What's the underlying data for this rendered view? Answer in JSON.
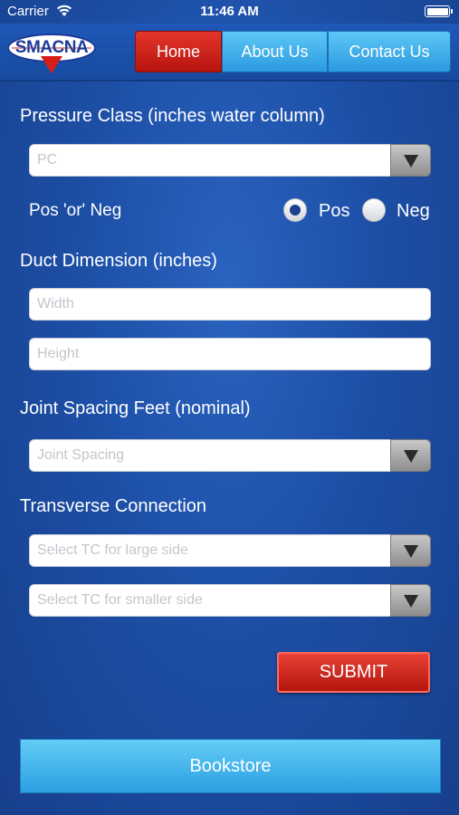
{
  "status_bar": {
    "carrier": "Carrier",
    "time": "11:46 AM"
  },
  "header": {
    "logo_text": "SMACNA",
    "nav": {
      "home": "Home",
      "about": "About Us",
      "contact": "Contact Us"
    },
    "active_tab": "home"
  },
  "pressure_class": {
    "label": "Pressure Class (inches water column)",
    "placeholder": "PC"
  },
  "pos_neg": {
    "label": "Pos 'or' Neg",
    "pos_label": "Pos",
    "neg_label": "Neg",
    "selected": "pos"
  },
  "duct_dimension": {
    "label": "Duct Dimension (inches)",
    "width_placeholder": "Width",
    "height_placeholder": "Height"
  },
  "joint_spacing": {
    "label": "Joint Spacing Feet (nominal)",
    "placeholder": "Joint Spacing"
  },
  "transverse_connection": {
    "label": "Transverse Connection",
    "large_side_placeholder": "Select TC for large side",
    "small_side_placeholder": "Select TC for smaller side"
  },
  "actions": {
    "submit": "SUBMIT",
    "bookstore": "Bookstore"
  },
  "colors": {
    "background": "#1d4fa6",
    "active_tab": "#c8201a",
    "tab": "#3aa8e8",
    "submit": "#c8201a"
  }
}
